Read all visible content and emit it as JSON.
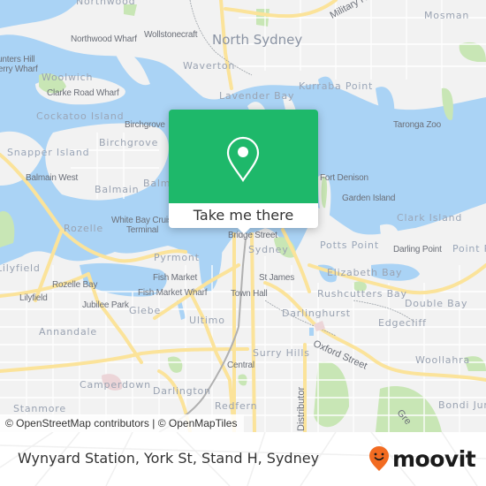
{
  "map": {
    "labels": {
      "city_north_sydney": "North Sydney",
      "military_road": "Military Road",
      "mosman": "Mosman",
      "northwood": "Northwood",
      "northwood_wharf": "Northwood Wharf",
      "wollstonecraft": "Wollstonecraft",
      "hunters_hill": "Hunters Hill",
      "ferry_wharf": "Ferry Wharf",
      "woolwich": "Woolwich",
      "waverton": "Waverton",
      "clarke_road_wharf": "Clarke Road Wharf",
      "lavender_bay": "Lavender Bay",
      "kurraba_point": "Kurraba Point",
      "cockatoo_island": "Cockatoo Island",
      "birchgrove": "Birchgrove",
      "taronga_zoo": "Taronga Zoo",
      "snapper_island": "Snapper Island",
      "balmain_west": "Balmain West",
      "balmain": "Balmain",
      "balmain_east": "Balmain",
      "fort_denison": "Fort Denison",
      "garden_island": "Garden Island",
      "clark_island": "Clark Island",
      "white_bay_cruise_1": "White Bay Cruise",
      "white_bay_cruise_2": "Terminal",
      "rozelle": "Rozelle",
      "bridge_street": "Bridge Street",
      "sydney": "Sydney",
      "potts_point": "Potts Point",
      "darling_point": "Darling Point",
      "point_piper": "Point Piper",
      "lilyfield_top": "Lilyfield",
      "pyrmont": "Pyrmont",
      "elizabeth_bay": "Elizabeth Bay",
      "rozelle_bay": "Rozelle Bay",
      "fish_market": "Fish Market",
      "st_james": "St James",
      "lilyfield": "Lilyfield",
      "fish_market_wharf": "Fish Market Wharf",
      "town_hall": "Town Hall",
      "rushcutters_bay": "Rushcutters Bay",
      "jubilee_park": "Jubilee Park",
      "glebe": "Glebe",
      "double_bay": "Double Bay",
      "darlinghurst": "Darlinghurst",
      "ultimo": "Ultimo",
      "edgecliff": "Edgecliff",
      "annandale": "Annandale",
      "oxford_street": "Oxford Street",
      "surry_hills": "Surry Hills",
      "central": "Central",
      "woollahra": "Woollahra",
      "camperdown": "Camperdown",
      "darlington": "Darlington",
      "redfern": "Redfern",
      "distributor": "Distributor",
      "stanmore": "Stanmore",
      "bondi_junction": "Bondi Junction",
      "greens": "Gre"
    },
    "attribution": "© OpenStreetMap contributors | © OpenMapTiles"
  },
  "popup": {
    "button_label": "Take me there",
    "icon": "map-pin-icon",
    "color": "#1eb86a"
  },
  "footer": {
    "station_name": "Wynyard Station, York St, Stand H, Sydney",
    "brand": "moovit",
    "brand_color": "#f26b21"
  }
}
